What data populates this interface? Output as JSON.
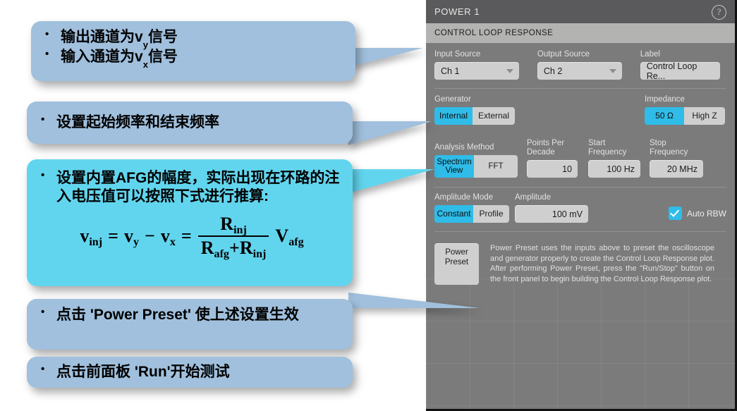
{
  "callouts": [
    {
      "id": "callout-1",
      "color": "#a0c0dd",
      "lines": [
        {
          "pre": "输出通道为v",
          "sub": "y",
          "post": "信号"
        },
        {
          "pre": "输入通道为v",
          "sub": "x",
          "post": "信号"
        }
      ]
    },
    {
      "id": "callout-2",
      "color": "#a0c0dd",
      "text": "设置起始频率和结束频率"
    },
    {
      "id": "callout-3",
      "color": "#62d5ee",
      "text": "设置内置AFG的幅度，实际出现在环路的注入电压值可以按照下式进行推算:",
      "formula": {
        "lhs_v": "v",
        "lhs_sub": "inj",
        "eq1": "=",
        "vy_v": "v",
        "vy_sub": "y",
        "minus": "−",
        "vx_v": "v",
        "vx_sub": "x",
        "eq2": "=",
        "num_R": "R",
        "num_sub": "inj",
        "den_R1": "R",
        "den_sub1": "afg",
        "den_plus": "+",
        "den_R2": "R",
        "den_sub2": "inj",
        "rhs_V": "V",
        "rhs_sub": "afg"
      }
    },
    {
      "id": "callout-4",
      "color": "#a0c0dd",
      "text": "点击 'Power Preset' 使上述设置生效"
    },
    {
      "id": "callout-5",
      "color": "#a0c0dd",
      "text": "点击前面板 'Run'开始测试"
    }
  ],
  "panel": {
    "title": "POWER 1",
    "help_icon": "help-circle-icon",
    "help_glyph": "?",
    "subtitle": "CONTROL LOOP RESPONSE",
    "accent_color": "#2fbce8",
    "background_color": "#7b7b7b",
    "input_source": {
      "label": "Input Source",
      "value": "Ch 1"
    },
    "output_source": {
      "label": "Output Source",
      "value": "Ch 2"
    },
    "label_field": {
      "label": "Label",
      "value": "Control Loop Re..."
    },
    "generator": {
      "label": "Generator",
      "options": [
        "Internal",
        "External"
      ],
      "selected": "Internal"
    },
    "impedance": {
      "label": "Impedance",
      "options": [
        "50 Ω",
        "High Z"
      ],
      "selected": "50 Ω"
    },
    "analysis_method": {
      "label": "Analysis Method",
      "options": [
        "Spectrum View",
        "FFT"
      ],
      "selected": "Spectrum View"
    },
    "points_per_decade": {
      "label": "Points Per\nDecade",
      "value": "10"
    },
    "start_frequency": {
      "label": "Start\nFrequency",
      "value": "100 Hz"
    },
    "stop_frequency": {
      "label": "Stop\nFrequency",
      "value": "20 MHz"
    },
    "amplitude_mode": {
      "label": "Amplitude Mode",
      "options": [
        "Constant",
        "Profile"
      ],
      "selected": "Constant"
    },
    "amplitude": {
      "label": "Amplitude",
      "value": "100 mV"
    },
    "auto_rbw": {
      "label": "Auto RBW",
      "checked": true
    },
    "power_preset": {
      "button_line1": "Power",
      "button_line2": "Preset",
      "description": "Power Preset uses the inputs above to preset the oscilloscope and generator properly to create the Control Loop Response plot. After performing Power Preset, press the \"Run/Stop\" button on the front panel to begin building the Control Loop Response plot."
    }
  }
}
